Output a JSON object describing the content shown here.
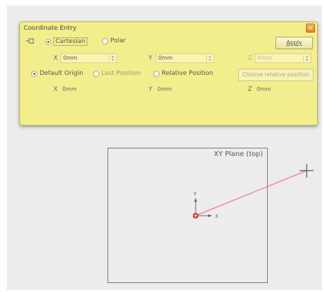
{
  "dialog": {
    "title": "Coordinate Entry",
    "close_glyph": "×",
    "mode_options": [
      {
        "label": "Cartesian",
        "selected": true
      },
      {
        "label": "Polar",
        "selected": false
      }
    ],
    "apply_label": "Apply",
    "input_row": {
      "x_label": "X",
      "x_value": "0mm",
      "y_label": "Y",
      "y_value": "0mm",
      "z_label": "Z",
      "z_value": "0mm"
    },
    "origin_options": [
      {
        "label": "Default Origin",
        "selected": true
      },
      {
        "label": "Last Position",
        "selected": false
      },
      {
        "label": "Relative Position",
        "selected": false
      }
    ],
    "choose_relative_label": "Choose relative position",
    "readout_row": {
      "x_label": "X",
      "x_value": "0mm",
      "y_label": "Y",
      "y_value": "0mm",
      "z_label": "Z",
      "z_value": "0mm"
    }
  },
  "viewport": {
    "plane_title": "XY Plane (top)",
    "axis_x_label": "X",
    "axis_y_label": "Y"
  },
  "colors": {
    "panel": "#f3ee8c",
    "line": "#f08a8a",
    "origin": "#d41c1c"
  },
  "icons": [
    "pin-icon",
    "close-icon",
    "spin-icon",
    "origin-marker-icon",
    "crosshair-cursor-icon"
  ]
}
